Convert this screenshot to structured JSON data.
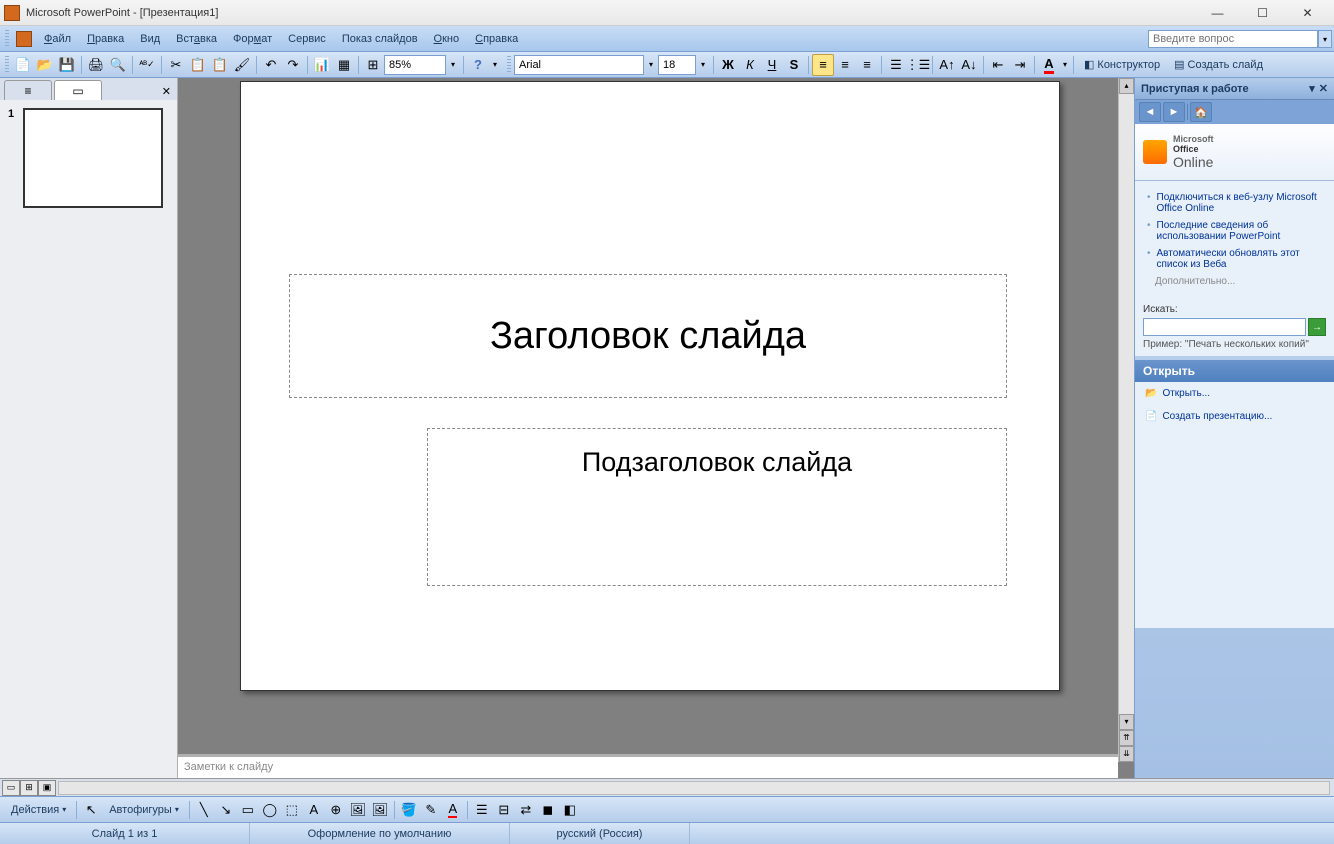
{
  "title": "Microsoft PowerPoint - [Презентация1]",
  "menu": {
    "file": "Файл",
    "edit": "Правка",
    "view": "Вид",
    "insert": "Вставка",
    "format": "Формат",
    "tools": "Сервис",
    "slideshow": "Показ слайдов",
    "window": "Окно",
    "help": "Справка"
  },
  "help_placeholder": "Введите вопрос",
  "toolbar": {
    "zoom": "85%",
    "font": "Arial",
    "size": "18",
    "designer": "Конструктор",
    "new_slide": "Создать слайд"
  },
  "outline": {
    "slide_number": "1"
  },
  "slide": {
    "title_placeholder": "Заголовок слайда",
    "subtitle_placeholder": "Подзаголовок слайда",
    "notes_placeholder": "Заметки к слайду"
  },
  "taskpane": {
    "title": "Приступая к работе",
    "office_small": "Microsoft",
    "office_big": "Office Online",
    "link1": "Подключиться к веб-узлу Microsoft Office Online",
    "link2": "Последние сведения об использовании PowerPoint",
    "link3": "Автоматически обновлять этот список из Веба",
    "more": "Дополнительно...",
    "search_label": "Искать:",
    "search_example": "Пример:",
    "search_example_text": "\"Печать нескольких копий\"",
    "open_head": "Открыть",
    "open_action": "Открыть...",
    "create_action": "Создать презентацию..."
  },
  "drawing": {
    "actions": "Действия",
    "autoshapes": "Автофигуры"
  },
  "status": {
    "slide": "Слайд 1 из 1",
    "design": "Оформление по умолчанию",
    "lang": "русский (Россия)"
  }
}
